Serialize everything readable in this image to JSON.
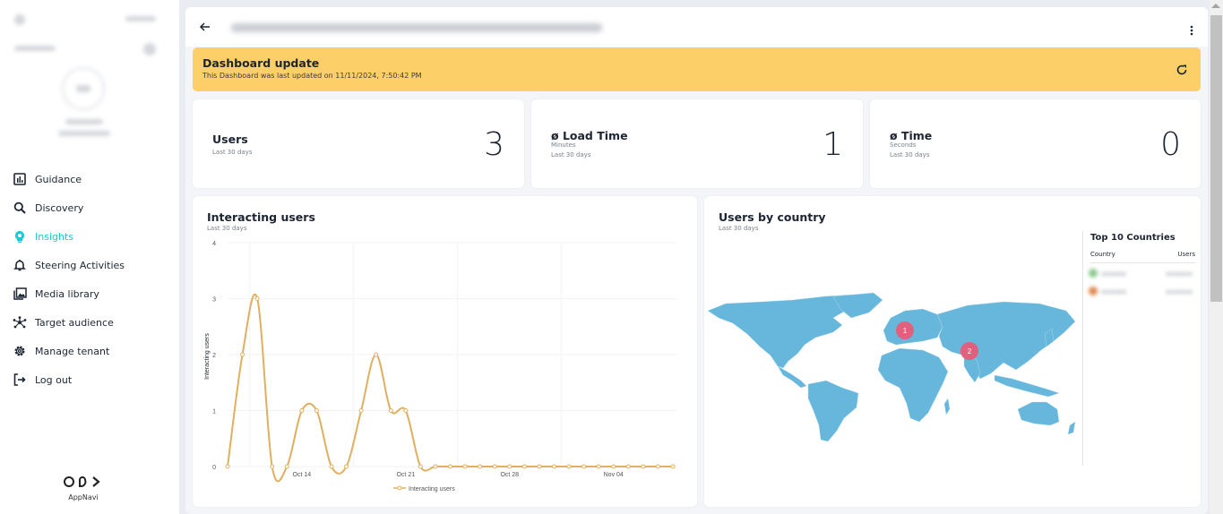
{
  "sidebar": {
    "nav": [
      {
        "label": "Guidance",
        "icon": "bar-chart-icon",
        "active": false
      },
      {
        "label": "Discovery",
        "icon": "search-icon",
        "active": false
      },
      {
        "label": "Insights",
        "icon": "lightbulb-icon",
        "active": true
      },
      {
        "label": "Steering Activities",
        "icon": "bell-icon",
        "active": false
      },
      {
        "label": "Media library",
        "icon": "image-library-icon",
        "active": false
      },
      {
        "label": "Target audience",
        "icon": "network-icon",
        "active": false
      },
      {
        "label": "Manage tenant",
        "icon": "gear-icon",
        "active": false
      },
      {
        "label": "Log out",
        "icon": "logout-icon",
        "active": false
      }
    ],
    "logo_text": "AppNavi"
  },
  "header": {
    "back_icon": "arrow-left-icon",
    "menu_icon": "kebab-icon"
  },
  "banner": {
    "title": "Dashboard update",
    "message": "This Dashboard was last updated on 11/11/2024, 7:50:42 PM",
    "refresh_icon": "refresh-icon",
    "color": "#fdcf68"
  },
  "kpis": [
    {
      "title": "Users",
      "unit": "",
      "period": "Last 30 days",
      "value": "3"
    },
    {
      "title": "ø Load Time",
      "unit": "Minutes",
      "period": "Last 30 days",
      "value": "1"
    },
    {
      "title": "ø Time",
      "unit": "Seconds",
      "period": "Last 30 days",
      "value": "0"
    }
  ],
  "interacting_chart": {
    "title": "Interacting users",
    "subtitle": "Last 30 days"
  },
  "map_card": {
    "title": "Users by country",
    "subtitle": "Last 30 days",
    "markers": [
      {
        "label": "1",
        "region": "Western Europe"
      },
      {
        "label": "2",
        "region": "South Asia"
      }
    ],
    "land_color": "#67b7dc",
    "marker_color": "#e0607e",
    "top10": {
      "title": "Top 10 Countries",
      "col_country": "Country",
      "col_users": "Users"
    }
  },
  "chart_data": {
    "type": "line",
    "title": "Interacting users",
    "subtitle": "Last 30 days",
    "xlabel": "",
    "ylabel": "Interacting users",
    "ylim": [
      0,
      4
    ],
    "yticks": [
      "0",
      "1",
      "2",
      "3",
      "4"
    ],
    "xticks": [
      {
        "label": "Oct 14",
        "index": 5
      },
      {
        "label": "Oct 21",
        "index": 12
      },
      {
        "label": "Oct 28",
        "index": 19
      },
      {
        "label": "Nov 04",
        "index": 26
      }
    ],
    "x": [
      "Oct 09",
      "Oct 10",
      "Oct 11",
      "Oct 12",
      "Oct 13",
      "Oct 14",
      "Oct 15",
      "Oct 16",
      "Oct 17",
      "Oct 18",
      "Oct 19",
      "Oct 20",
      "Oct 21",
      "Oct 22",
      "Oct 23",
      "Oct 24",
      "Oct 25",
      "Oct 26",
      "Oct 27",
      "Oct 28",
      "Oct 29",
      "Oct 30",
      "Oct 31",
      "Nov 01",
      "Nov 02",
      "Nov 03",
      "Nov 04",
      "Nov 05",
      "Nov 06",
      "Nov 07",
      "Nov 08"
    ],
    "series": [
      {
        "name": "Interacting users",
        "color": "#e0b060",
        "values": [
          0,
          2,
          3,
          0,
          0,
          1,
          1,
          0,
          0,
          1,
          2,
          1,
          1,
          0,
          0,
          0,
          0,
          0,
          0,
          0,
          0,
          0,
          0,
          0,
          0,
          0,
          0,
          0,
          0,
          0,
          0
        ]
      }
    ],
    "grid": true,
    "legend": "bottom"
  }
}
